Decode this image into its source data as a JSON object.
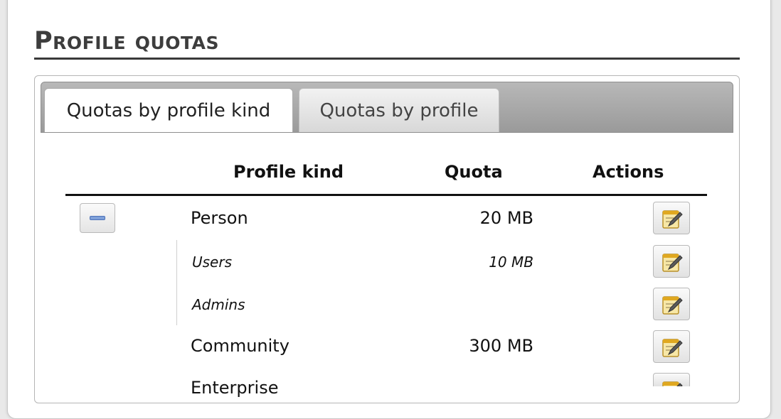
{
  "page": {
    "title": "Profile quotas"
  },
  "tabs": [
    {
      "label": "Quotas by profile kind",
      "active": true
    },
    {
      "label": "Quotas by profile",
      "active": false
    }
  ],
  "table": {
    "columns": [
      "Profile kind",
      "Quota",
      "Actions"
    ],
    "rows": [
      {
        "kind": "Person",
        "quota": "20 MB",
        "level": "parent"
      },
      {
        "kind": "Users",
        "quota": "10 MB",
        "level": "child"
      },
      {
        "kind": "Admins",
        "quota": "",
        "level": "child"
      },
      {
        "kind": "Community",
        "quota": "300 MB",
        "level": "parent"
      },
      {
        "kind": "Enterprise",
        "quota": "",
        "level": "parent"
      }
    ]
  },
  "icons": {
    "collapse": "minus-icon",
    "edit": "edit-icon"
  },
  "colors": {
    "title": "#3d3d3d",
    "collapse_accent": "#7ea0d8",
    "edit_icon": "#e0a820"
  }
}
